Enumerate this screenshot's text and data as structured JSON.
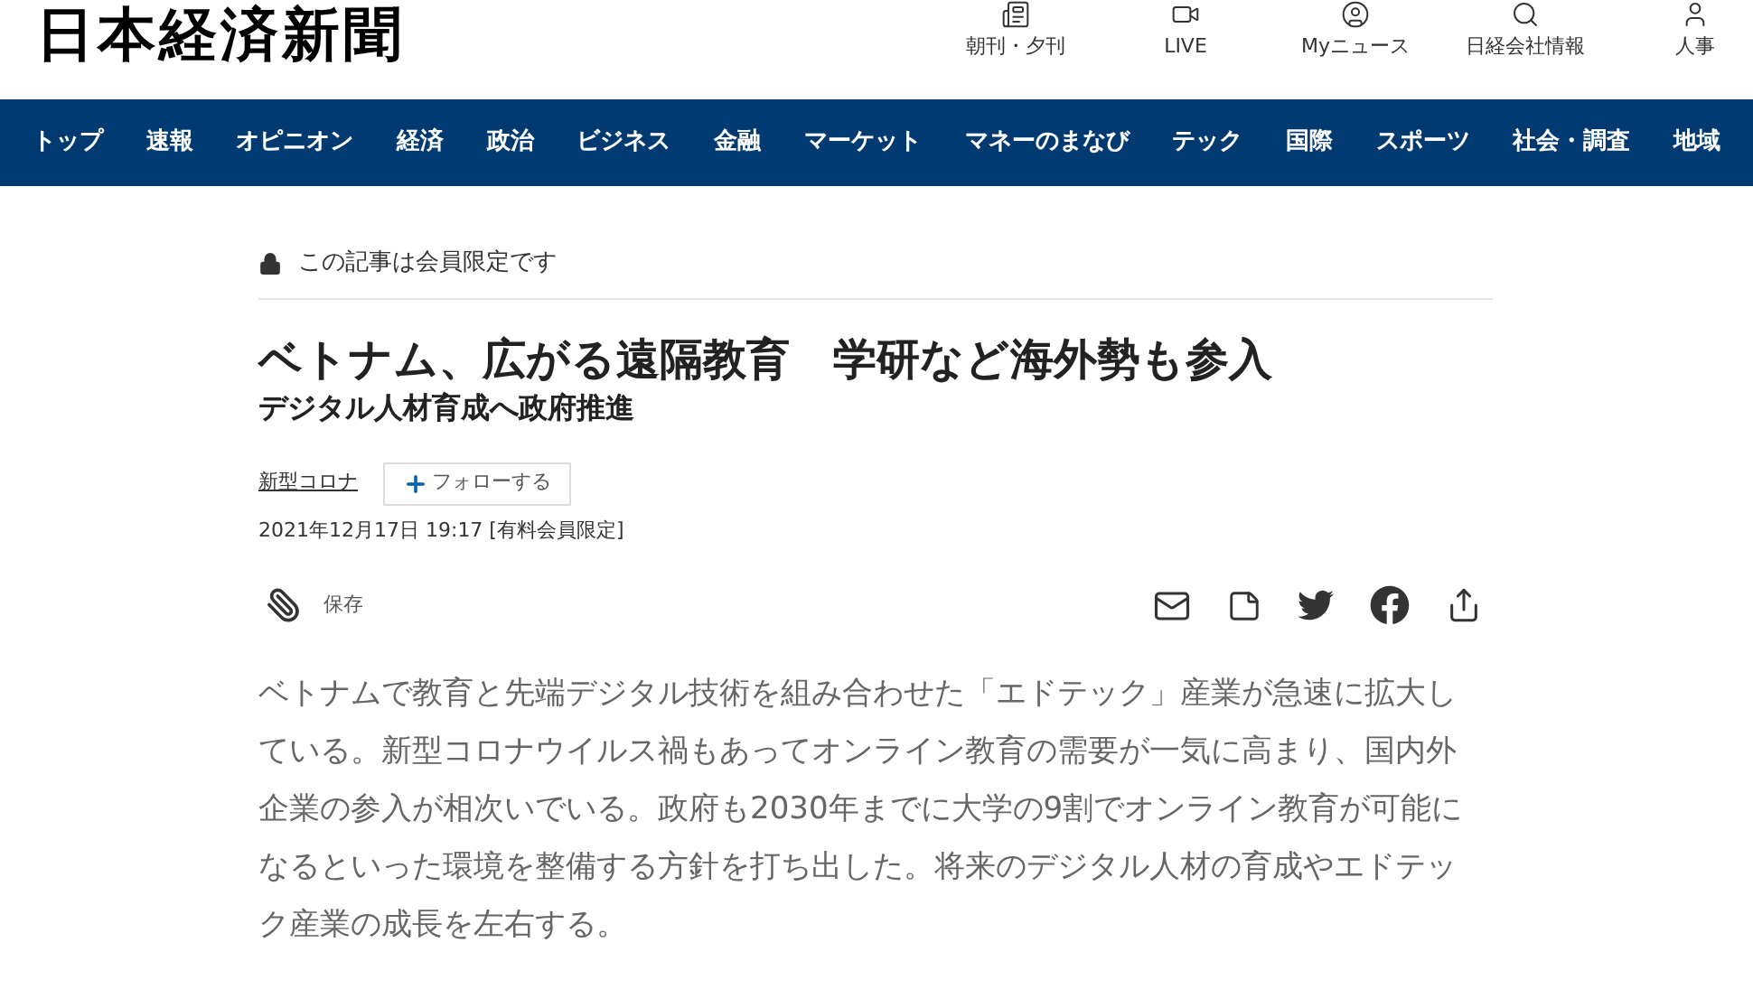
{
  "header": {
    "logo": "日本経済新聞",
    "links": [
      {
        "label": "朝刊・夕刊",
        "kind": "paper"
      },
      {
        "label": "LIVE",
        "kind": "video"
      },
      {
        "label": "Myニュース",
        "kind": "user"
      },
      {
        "label": "日経会社情報",
        "kind": "search"
      },
      {
        "label": "人事",
        "kind": "person"
      }
    ]
  },
  "nav": [
    "トップ",
    "速報",
    "オピニオン",
    "経済",
    "政治",
    "ビジネス",
    "金融",
    "マーケット",
    "マネーのまなび",
    "テック",
    "国際",
    "スポーツ",
    "社会・調査",
    "地域"
  ],
  "article": {
    "notice": "この記事は会員限定です",
    "title": "ベトナム、広がる遠隔教育　学研など海外勢も参入",
    "subtitle": "デジタル人材育成へ政府推進",
    "topic": "新型コロナ",
    "follow": "フォローする",
    "date": "2021年12月17日 19:17 [有料会員限定]",
    "save": "保存",
    "body": "ベトナムで教育と先端デジタル技術を組み合わせた「エドテック」産業が急速に拡大している。新型コロナウイルス禍もあってオンライン教育の需要が一気に高まり、国内外企業の参入が相次いでいる。政府も2030年までに大学の9割でオンライン教育が可能になるといった環境を整備する方針を打ち出した。将来のデジタル人材の育成やエドテック産業の成長を左右する。"
  }
}
